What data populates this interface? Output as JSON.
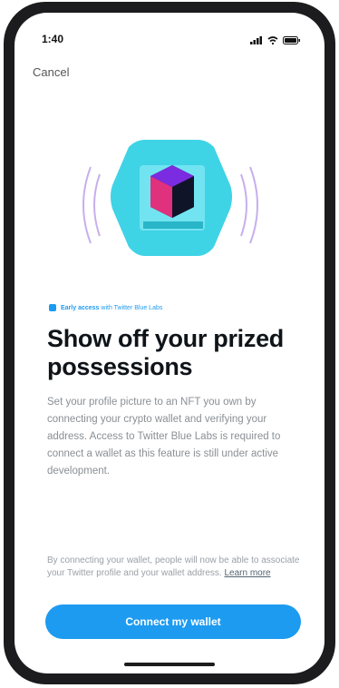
{
  "status_bar": {
    "time": "1:40"
  },
  "nav": {
    "cancel_label": "Cancel"
  },
  "badge": {
    "bold": "Early access",
    "rest": "with Twitter Blue Labs"
  },
  "headline": "Show off your prized possessions",
  "description": "Set your profile picture to an NFT you own by connecting your crypto wallet and verifying your address. Access to Twitter Blue Labs is required to connect a wallet as this feature is still under active development.",
  "footnote": {
    "text": "By connecting your wallet, people will now be able to associate your Twitter profile and your wallet address.",
    "link": "Learn more"
  },
  "cta": {
    "label": "Connect my wallet"
  },
  "colors": {
    "accent": "#1d9bf0",
    "hero_cyan": "#3fd3e6",
    "text": "#0f1419"
  },
  "icons": [
    "signal-icon",
    "wifi-icon",
    "battery-icon",
    "nft-cube-icon",
    "badge-icon"
  ]
}
